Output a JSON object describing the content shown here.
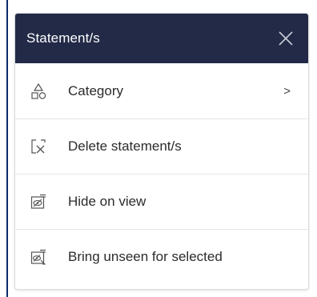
{
  "menu": {
    "title": "Statement/s",
    "close_icon": "close-icon",
    "items": [
      {
        "label": "Category",
        "icon": "category-shapes-icon",
        "has_submenu": true,
        "submenu_glyph": ">"
      },
      {
        "label": "Delete statement/s",
        "icon": "delete-selection-icon",
        "has_submenu": false
      },
      {
        "label": "Hide on view",
        "icon": "hide-on-view-icon",
        "has_submenu": false
      },
      {
        "label": "Bring unseen for selected",
        "icon": "bring-unseen-icon",
        "has_submenu": false
      }
    ]
  },
  "colors": {
    "header_bg": "#222a47",
    "header_text": "#ffffff",
    "item_text": "#2b2b2b",
    "divider": "#e6e6e6",
    "icon_stroke": "#555555"
  }
}
